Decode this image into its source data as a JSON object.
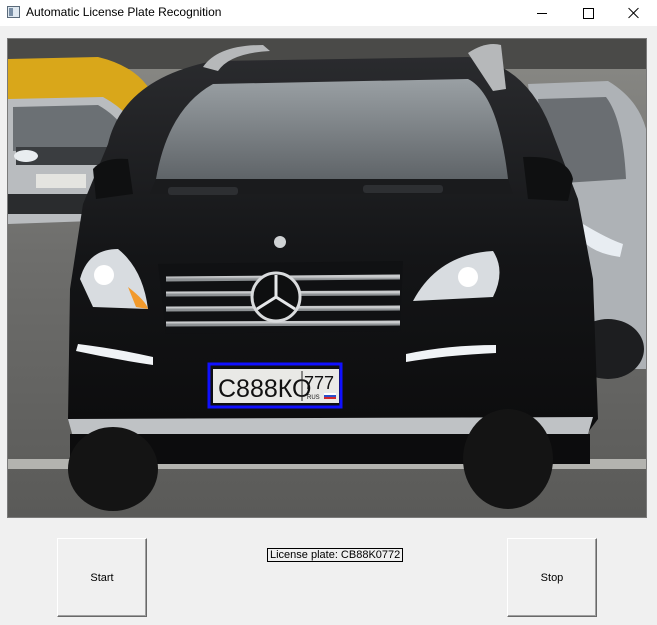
{
  "window": {
    "title": "Automatic License Plate Recognition"
  },
  "camera": {
    "plate_text_main": "С888КО",
    "plate_region": "777",
    "plate_country": "RUS",
    "detection_box_color": "#1010ff"
  },
  "controls": {
    "start_label": "Start",
    "stop_label": "Stop",
    "status_text": "License plate: CB88K0772"
  }
}
